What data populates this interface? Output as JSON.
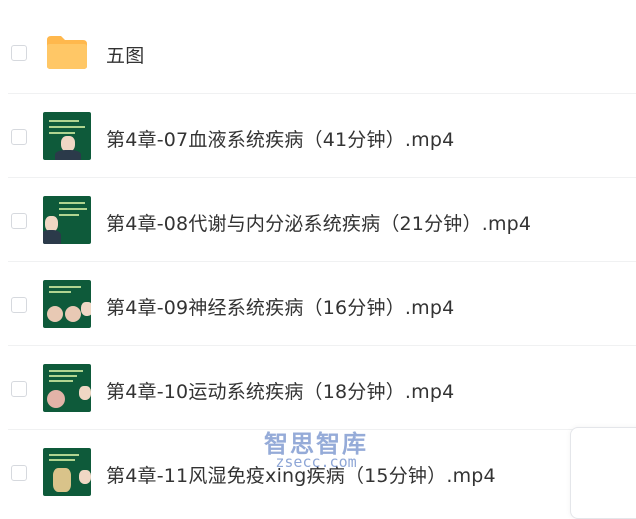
{
  "files": [
    {
      "name": "五图",
      "type": "folder",
      "icon": "folder-icon"
    },
    {
      "name": "第4章-07血液系统疾病（41分钟）.mp4",
      "type": "video"
    },
    {
      "name": "第4章-08代谢与内分泌系统疾病（21分钟）.mp4",
      "type": "video"
    },
    {
      "name": "第4章-09神经系统疾病（16分钟）.mp4",
      "type": "video"
    },
    {
      "name": "第4章-10运动系统疾病（18分钟）.mp4",
      "type": "video"
    },
    {
      "name": "第4章-11风湿免疫xing疾病（15分钟）.mp4",
      "type": "video"
    }
  ],
  "watermark": {
    "title": "智思智库",
    "url": "zsecc.com"
  },
  "colors": {
    "folder": "#ffc766",
    "thumb_bg": "#0e5a3a",
    "checkbox_border": "#d6d9de",
    "divider": "#f0f1f2"
  }
}
